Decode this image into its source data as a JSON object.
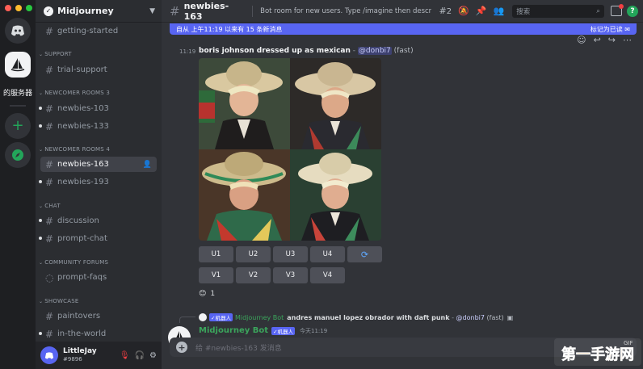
{
  "window": {
    "traffic_lights": [
      "#ff5f57",
      "#febc2e",
      "#28c840"
    ]
  },
  "rail": {
    "server_label": "的服务器"
  },
  "guild": {
    "name": "Midjourney"
  },
  "sidebar": {
    "channels": [
      {
        "label": "getting-started"
      },
      {
        "category": "SUPPORT"
      },
      {
        "label": "trial-support"
      },
      {
        "category": "NEWCOMER ROOMS 3"
      },
      {
        "label": "newbies-103"
      },
      {
        "label": "newbies-133"
      },
      {
        "category": "NEWCOMER ROOMS 4"
      },
      {
        "label": "newbies-163",
        "active": true
      },
      {
        "label": "newbies-193"
      },
      {
        "category": "CHAT"
      },
      {
        "label": "discussion"
      },
      {
        "label": "prompt-chat"
      },
      {
        "category": "COMMUNITY FORUMS"
      },
      {
        "label": "prompt-faqs"
      },
      {
        "category": "SHOWCASE"
      },
      {
        "label": "paintovers"
      },
      {
        "label": "in-the-world"
      }
    ]
  },
  "user": {
    "name": "LittleJay",
    "tag": "#9896"
  },
  "topbar": {
    "channel": "newbies-163",
    "topic": "Bot room for new users. Type /imagine then describe ...",
    "thread_count": "2",
    "search_placeholder": "搜索"
  },
  "banner": {
    "text": "自从 上午11:19 以来有 15 条新消息",
    "mark_read": "标记为已读"
  },
  "message": {
    "time": "11:19",
    "prompt": "boris johnson dressed up as mexican",
    "dash": " - ",
    "mention": "@donbi7",
    "mode": "(fast)",
    "buttons_row1": [
      "U1",
      "U2",
      "U3",
      "U4"
    ],
    "buttons_row2": [
      "V1",
      "V2",
      "V3",
      "V4"
    ],
    "reaction_emoji": "😊",
    "reaction_count": "1"
  },
  "next_message": {
    "reply_tag": "✓机器人",
    "reply_author": "Midjourney Bot",
    "reply_text": "andres manuel lopez obrador with daft punk",
    "reply_mention": "@donbi7",
    "reply_mode": "(fast)",
    "author": "Midjourney Bot",
    "bot_tag": "✓机器人",
    "time": "今天11:19"
  },
  "composer": {
    "placeholder": "给 #newbies-163 发消息"
  },
  "watermark": {
    "text": "第一手游网",
    "sub": "GIF"
  },
  "colors": {
    "accent": "#5865f2",
    "bot_green": "#3ba55c",
    "active_channel": "#404249"
  }
}
